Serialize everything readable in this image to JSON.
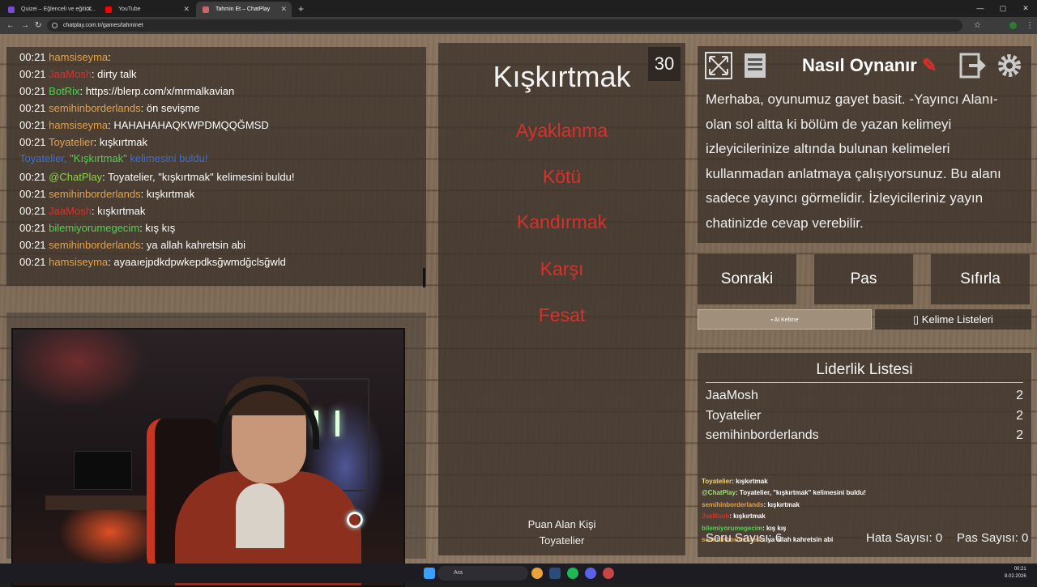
{
  "browser": {
    "tabs": [
      {
        "label": "Quizei – Eğlenceli ve eğitici…",
        "active": false,
        "fav_color": "#7a4bd0"
      },
      {
        "label": "YouTube",
        "active": false,
        "fav_color": "#ff0000"
      },
      {
        "label": "Tahmin Et – ChatPlay",
        "active": true,
        "fav_color": "#c66"
      }
    ],
    "new_tab": "+",
    "url": "chatplay.com.tr/games/tahminet"
  },
  "chat": {
    "messages": [
      {
        "time": "00:21",
        "user": "hamsiseyma",
        "color": "#e3a24a",
        "text": ""
      },
      {
        "time": "00:21",
        "user": "JaaMosh",
        "color": "#d8312b",
        "text": " dirty talk"
      },
      {
        "time": "00:21",
        "user": "BotRix",
        "color": "#52d152",
        "text": " https://blerp.com/x/mrmalkavian"
      },
      {
        "time": "00:21",
        "user": "semihinborderlands",
        "color": "#e3a24a",
        "text": " ön sevişme"
      },
      {
        "time": "00:21",
        "user": "hamsiseyma",
        "color": "#e3a24a",
        "text": " HAHAHAHAQKWPDMQQĞMSD"
      },
      {
        "time": "00:21",
        "user": "Toyatelier",
        "color": "#e3a24a",
        "text": " kışkırtmak"
      },
      {
        "time": "",
        "user": "",
        "color": "",
        "text": ""
      },
      {
        "time": "00:21",
        "user": "@ChatPlay",
        "color": "#8fd14f",
        "text": " Toyatelier, \"kışkırtmak\" kelimesini buldu!"
      },
      {
        "time": "00:21",
        "user": "semihinborderlands",
        "color": "#e3a24a",
        "text": " kışkırtmak"
      },
      {
        "time": "00:21",
        "user": "JaaMosh",
        "color": "#d8312b",
        "text": " kışkırtmak"
      },
      {
        "time": "00:21",
        "user": "bilemiyorumegecim",
        "color": "#52d152",
        "text": " kış kış"
      },
      {
        "time": "00:21",
        "user": "semihinborderlands",
        "color": "#e3a24a",
        "text": " ya allah kahretsin abi"
      },
      {
        "time": "00:21",
        "user": "hamsiseyma",
        "color": "#e3a24a",
        "text": " ayaaıejpdkdpwkepdksğwmdğclsğwld"
      }
    ],
    "system": {
      "prefix": "Toyatelier, ",
      "word": "\"Kışkırtmak\"",
      "suffix": " kelimesini buldu!"
    }
  },
  "game": {
    "word": "Kışkırtmak",
    "timer": "30",
    "forbidden": [
      "Ayaklanma",
      "Kötü",
      "Kandırmak",
      "Karşı",
      "Fesat"
    ],
    "scorer_label": "Puan Alan Kişi",
    "scorer_name": "Toyatelier"
  },
  "info": {
    "title": "Nasıl Oynanır",
    "text": "Merhaba, oyunumuz gayet basit. -Yayıncı Alanı- olan sol altta ki bölüm de yazan kelimeyi izleyicilerinize altında bulunan kelimeleri kullanmadan anlatmaya çalışıyorsunuz. Bu alanı sadece yayıncı görmelidir. İzleyicileriniz yayın chatinizde cevap verebilir."
  },
  "buttons": {
    "next": "Sonraki",
    "pass": "Pas",
    "reset": "Sıfırla",
    "ai_word": "AI Kelime",
    "word_lists": "Kelime Listeleri"
  },
  "leaderboard": {
    "title": "Liderlik Listesi",
    "rows": [
      {
        "name": "JaaMosh",
        "score": "2"
      },
      {
        "name": "Toyatelier",
        "score": "2"
      },
      {
        "name": "semihinborderlands",
        "score": "2"
      }
    ]
  },
  "mini_chat": [
    {
      "user": "Toyatelier",
      "color": "#f2d37a",
      "text": ": kışkırtmak"
    },
    {
      "user": "@ChatPlay",
      "color": "#9fe07a",
      "text": ": Toyatelier, \"kışkırtmak\" kelimesini buldu!"
    },
    {
      "user": "semihinborderlands",
      "color": "#e3a24a",
      "text": ": kışkırtmak"
    },
    {
      "user": "JaaMosh",
      "color": "#d8312b",
      "text": ": kışkırtmak"
    },
    {
      "user": "bilemiyorumegecim",
      "color": "#52d152",
      "text": ": kış kış"
    },
    {
      "user": "semihinborderlands",
      "color": "#e3a24a",
      "text": ": ya allah kahretsin abi"
    }
  ],
  "counters": {
    "round": "Soru Sayısı: 6",
    "errors": "Hata Sayısı: 0",
    "passes": "Pas Sayısı: 0"
  },
  "taskbar": {
    "search": "Ara",
    "time": "00:21",
    "date": "8.02.2026"
  }
}
